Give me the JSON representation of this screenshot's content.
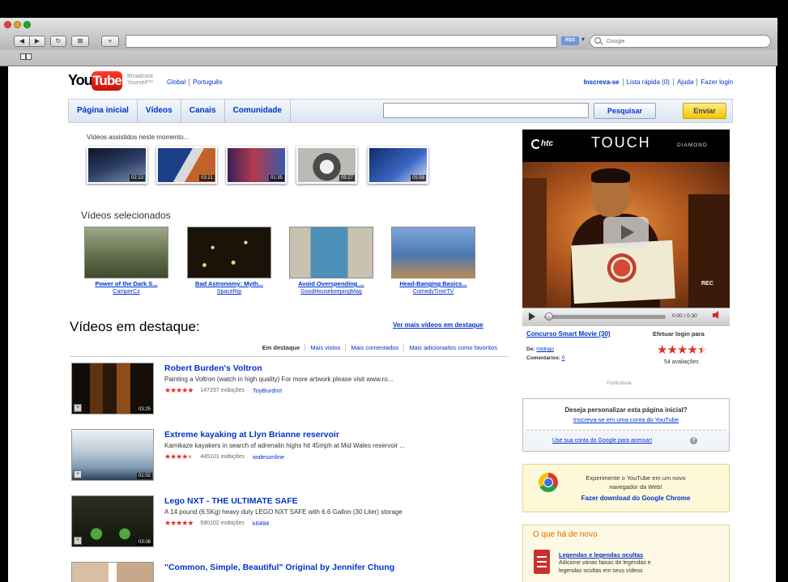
{
  "colors": {
    "brand_red": "#e62117",
    "link": "#0033cc",
    "upload_yellow": "#f5c800",
    "accent_orange": "#e06a00",
    "star_red": "#e0312a"
  },
  "browser": {
    "search_placeholder": "Google",
    "rss_badge": "RSS"
  },
  "header": {
    "logo_you": "You",
    "logo_tube": "Tube",
    "tagline_line1": "Broadcast",
    "tagline_line2": "Yourself™",
    "lang_global": "Global",
    "lang_pt": "Português",
    "signup": "Inscreva-se",
    "quicklist": "Lista rápida (0)",
    "help": "Ajuda",
    "login": "Fazer login"
  },
  "nav": {
    "tabs": [
      "Página inicial",
      "Vídeos",
      "Canais",
      "Comunidade"
    ],
    "search_value": "",
    "search_button": "Pesquisar",
    "upload_button": "Enviar"
  },
  "watching": {
    "heading": "Vídeos assistidos neste momento...",
    "items": [
      {
        "duration": "02:13"
      },
      {
        "duration": "03:21"
      },
      {
        "duration": "01:35"
      },
      {
        "duration": "05:27"
      },
      {
        "duration": "05:58"
      }
    ]
  },
  "selected": {
    "heading": "Vídeos selecionados",
    "items": [
      {
        "title": "Power of the Dark S...",
        "user": "CamperCz"
      },
      {
        "title": "Bad Astronomy: Myth...",
        "user": "SpaceRip"
      },
      {
        "title": "Avoid Overspending ...",
        "user": "GoodHousekeepingMag"
      },
      {
        "title": "Head-Banging Basics...",
        "user": "ComedyTimeTV"
      }
    ]
  },
  "featured": {
    "heading": "Vídeos em destaque:",
    "more_link": "Ver mais vídeos em destaque",
    "tabs": [
      "Em destaque",
      "Mais vistos",
      "Mais comentados",
      "Mais adicionados como favoritos"
    ],
    "items": [
      {
        "title": "Robert Burden's Voltron",
        "description": "Painting a Voltron (watch in high quality) For more artwork please visit www.ro...",
        "rating": 5,
        "views": "147297 exibições",
        "user": "ToyBurdnrt",
        "duration": "03:25"
      },
      {
        "title": "Extreme kayaking at Llyn Brianne reservoir",
        "description": "Kamikaze kayakers in search of adrenalin highs hit 45mph at Mid Wales reservoir ...",
        "rating": 4.5,
        "views": "445101 exibições",
        "user": "walesonline",
        "duration": "01:02"
      },
      {
        "title": "Lego NXT - THE ULTIMATE SAFE",
        "description": "A 14 pound (6.5Kg) heavy duty LEGO NXT SAFE with 6.6 Gallon (30 Liter) storage",
        "rating": 5,
        "views": "590102 exibições",
        "user": "k6484",
        "duration": "03:08"
      },
      {
        "title": "\"Common, Simple, Beautiful\" Original by Jennifer Chung"
      }
    ]
  },
  "player": {
    "brand": "htc",
    "product": "TOUCH",
    "product_sub": "DIAMOND",
    "overlay_text": "REC",
    "time": "0:00 / 0:30",
    "progress": 0,
    "title": "Concurso Smart Movie (30)",
    "login_prompt": "Efetuar login para",
    "from_label": "De:",
    "from_user": "mtdngo",
    "comments_label": "Comentários:",
    "comments_count": "0",
    "rating": 4.5,
    "ratings_count": "54 avaliações",
    "ad_label": "Publicidade"
  },
  "personalize": {
    "question": "Deseja personalizar esta página inicial?",
    "signup_link": "Inscreva-se em uma conta do YouTube",
    "google_link": "Use sua conta do Google para acessar!",
    "help_icon": "?"
  },
  "chrome_promo": {
    "line1": "Experimente o YouTube em um novo",
    "line2": "navegador da Web!",
    "link": "Fazer download do Google Chrome"
  },
  "whats_new": {
    "heading": "O que há de novo",
    "link": "Legendas e legendas ocultas",
    "line1": "Adicione várias faixas de legendas e",
    "line2": "legendas ocultas em seus vídeos"
  }
}
